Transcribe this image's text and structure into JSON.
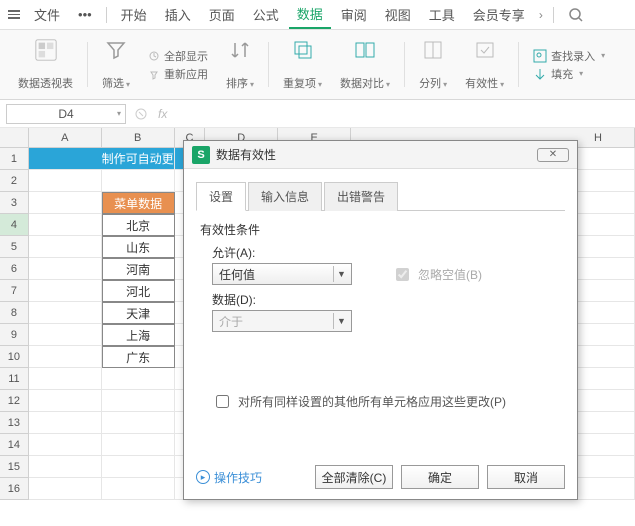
{
  "menubar": {
    "file": "文件",
    "items": [
      "开始",
      "插入",
      "页面",
      "公式",
      "数据",
      "审阅",
      "视图",
      "工具",
      "会员专享"
    ],
    "active_index": 4
  },
  "ribbon": {
    "pivot": "数据透视表",
    "filter": "筛选",
    "show_all": "全部显示",
    "reapply": "重新应用",
    "sort": "排序",
    "dup": "重复项",
    "validation": "数据对比",
    "split": "分列",
    "validity": "有效性",
    "find_import": "查找录入",
    "fill": "填充"
  },
  "cellref": "D4",
  "columns": [
    "A",
    "B",
    "C",
    "D",
    "E",
    "H"
  ],
  "rows_count": 16,
  "title_cell": "制作可自动更",
  "list_header": "菜单数据",
  "list_items": [
    "北京",
    "山东",
    "河南",
    "河北",
    "天津",
    "上海",
    "广东"
  ],
  "selected_row": 4,
  "dialog": {
    "title": "数据有效性",
    "tabs": [
      "设置",
      "输入信息",
      "出错警告"
    ],
    "active_tab": 0,
    "section": "有效性条件",
    "allow_label": "允许(A):",
    "allow_value": "任何值",
    "ignore_blank": "忽略空值(B)",
    "data_label": "数据(D):",
    "data_value": "介于",
    "apply_others": "对所有同样设置的其他所有单元格应用这些更改(P)",
    "tips": "操作技巧",
    "clear_all": "全部清除(C)",
    "ok": "确定",
    "cancel": "取消"
  }
}
